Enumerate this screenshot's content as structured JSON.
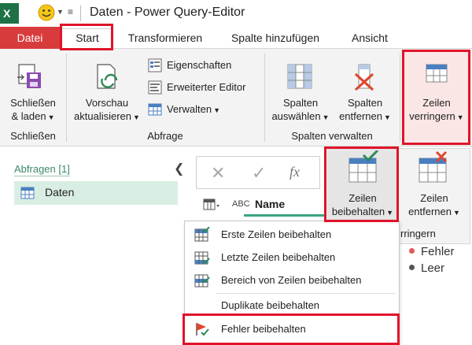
{
  "window": {
    "title": "Daten - Power Query-Editor"
  },
  "tabs": [
    {
      "label": "Datei"
    },
    {
      "label": "Start"
    },
    {
      "label": "Transformieren"
    },
    {
      "label": "Spalte hinzufügen"
    },
    {
      "label": "Ansicht"
    }
  ],
  "ribbon": {
    "close_load": {
      "line1": "Schließen",
      "line2": "& laden"
    },
    "refresh": {
      "line1": "Vorschau",
      "line2": "aktualisieren"
    },
    "properties": "Eigenschaften",
    "advanced_editor": "Erweiterter Editor",
    "manage": "Verwalten",
    "choose_cols": {
      "line1": "Spalten",
      "line2": "auswählen"
    },
    "remove_cols": {
      "line1": "Spalten",
      "line2": "entfernen"
    },
    "reduce_rows": {
      "line1": "Zeilen",
      "line2": "verringern"
    },
    "groups": {
      "close": "Schließen",
      "query": "Abfrage",
      "manage_cols": "Spalten verwalten"
    }
  },
  "popup_ribbon": {
    "keep_rows": {
      "line1": "Zeilen",
      "line2": "beibehalten"
    },
    "remove_rows": {
      "line1": "Zeilen",
      "line2": "entfernen"
    },
    "group_fragment": "rringern"
  },
  "queries_pane": {
    "header": "Abfragen [1]",
    "items": [
      {
        "label": "Daten"
      }
    ]
  },
  "formula_bar": {
    "fx": "fx"
  },
  "grid": {
    "column_type": "ABC",
    "column_name": "Name"
  },
  "menu": {
    "items": [
      {
        "label": "Erste Zeilen beibehalten"
      },
      {
        "label": "Letzte Zeilen beibehalten"
      },
      {
        "label": "Bereich von Zeilen beibehalten"
      },
      {
        "label": "Duplikate beibehalten"
      },
      {
        "label": "Fehler beibehalten"
      }
    ]
  },
  "legend": [
    {
      "label": "Fehler",
      "color": "#e05a5a"
    },
    {
      "label": "Leer",
      "color": "#555555"
    }
  ],
  "colors": {
    "accent_red": "#e0142a",
    "file_tab": "#d83b3b",
    "selected_query": "#d9eee3",
    "column_underline": "#3ca57f"
  }
}
